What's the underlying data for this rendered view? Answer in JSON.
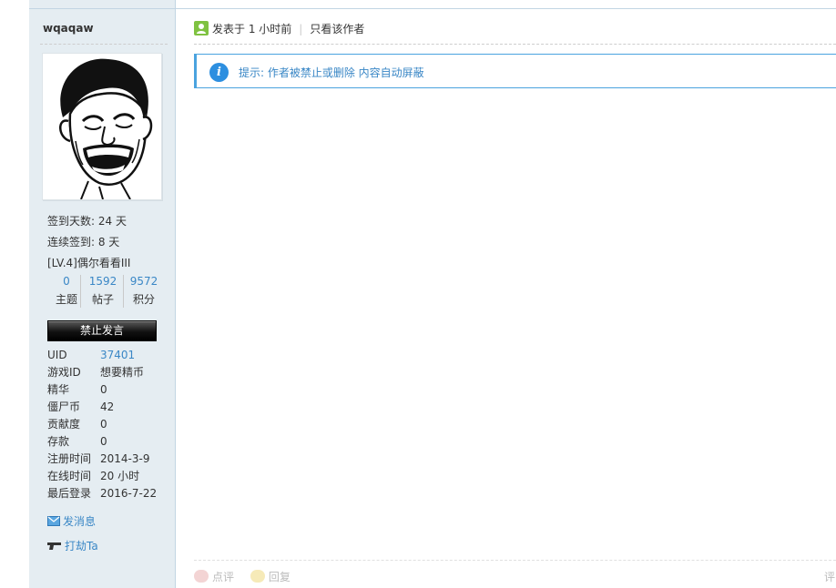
{
  "author": {
    "username": "wqaqaw",
    "sign_days_label": "签到天数: 24 天",
    "streak_label": "连续签到: 8 天",
    "level_label": "[LV.4]偶尔看看III",
    "counts": [
      {
        "value": "0",
        "label": "主题"
      },
      {
        "value": "1592",
        "label": "帖子"
      },
      {
        "value": "9572",
        "label": "积分"
      }
    ],
    "ban_button": "禁止发言",
    "info": [
      {
        "key": "UID",
        "value": "37401"
      },
      {
        "key": "游戏ID",
        "value": "想要精币"
      },
      {
        "key": "精华",
        "value": "0"
      },
      {
        "key": "僵尸币",
        "value": "42"
      },
      {
        "key": "贡献度",
        "value": "0"
      },
      {
        "key": "存款",
        "value": "0"
      },
      {
        "key": "注册时间",
        "value": "2014-3-9"
      },
      {
        "key": "在线时间",
        "value": "20 小时"
      },
      {
        "key": "最后登录",
        "value": "2016-7-22"
      }
    ],
    "send_message": "发消息",
    "poke": "打劫Ta"
  },
  "post": {
    "posted_label": "发表于 1 小时前",
    "only_author": "只看该作者",
    "notice": "提示: 作者被禁止或删除 内容自动屏蔽",
    "actions": {
      "comment": "点评",
      "reply": "回复",
      "rate": "评"
    }
  },
  "colors": {
    "link": "#3a87c6",
    "sidebar_bg": "#e5edf2",
    "border": "#c2d5e3"
  }
}
